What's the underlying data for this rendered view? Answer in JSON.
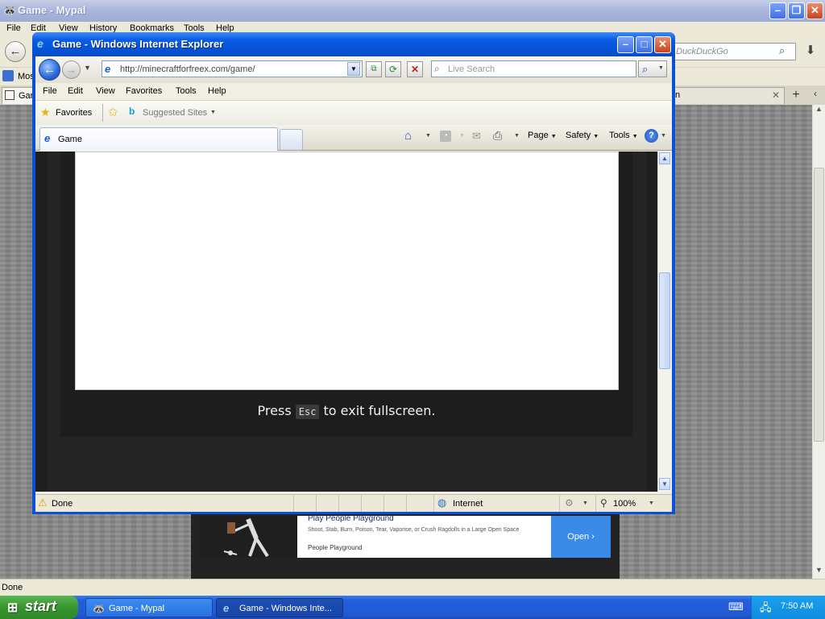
{
  "background_window": {
    "title": "Game - Mypal",
    "menu": [
      "File",
      "Edit",
      "View",
      "History",
      "Bookmarks",
      "Tools",
      "Help"
    ],
    "search_placeholder": "DuckDuckGo",
    "bookmark_item": "Mos",
    "tab_label": "Gar",
    "status": "Done"
  },
  "ad": {
    "title": "Play People Playground",
    "description": "Shoot, Stab, Burn, Poison, Tear, Vaporise, or Crush Ragdolls in a Large Open Space",
    "advertiser": "People Playground",
    "cta": "Open"
  },
  "ie_window": {
    "title": "Game - Windows Internet Explorer",
    "address": "http://minecraftforfreex.com/game/",
    "search_placeholder": "Live Search",
    "menu": [
      "File",
      "Edit",
      "View",
      "Favorites",
      "Tools",
      "Help"
    ],
    "favorites_label": "Favorites",
    "suggested_sites": "Suggested Sites",
    "tab_label": "Game",
    "command_bar": [
      "Page",
      "Safety",
      "Tools"
    ],
    "page": {
      "press": "Press",
      "key": "Esc",
      "rest": "to exit fullscreen."
    },
    "status": {
      "text": "Done",
      "zone": "Internet",
      "zoom": "100%"
    }
  },
  "taskbar": {
    "start": "start",
    "tasks": [
      "Game - Mypal",
      "Game - Windows Inte..."
    ],
    "clock": "7:50 AM"
  }
}
